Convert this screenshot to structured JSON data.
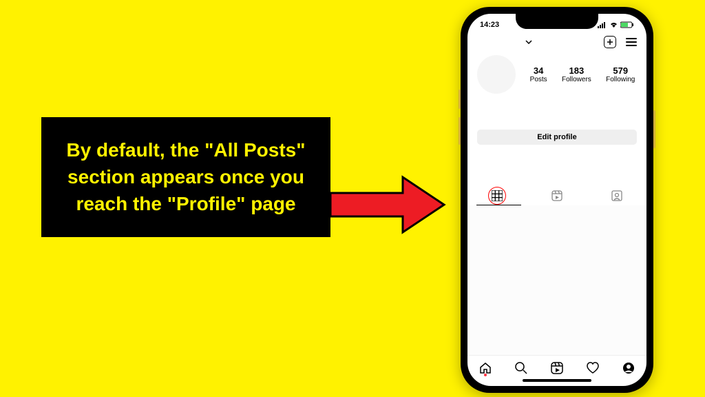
{
  "caption": "By default, the \"All Posts\" section appears once you reach the \"Profile\" page",
  "status": {
    "time": "14:23"
  },
  "profile": {
    "stats": {
      "posts": {
        "count": "34",
        "label": "Posts"
      },
      "followers": {
        "count": "183",
        "label": "Followers"
      },
      "following": {
        "count": "579",
        "label": "Following"
      }
    },
    "edit_button": "Edit profile"
  },
  "colors": {
    "bg": "#FFF200",
    "arrow": "#ED1C24",
    "highlight": "#FF0000"
  }
}
